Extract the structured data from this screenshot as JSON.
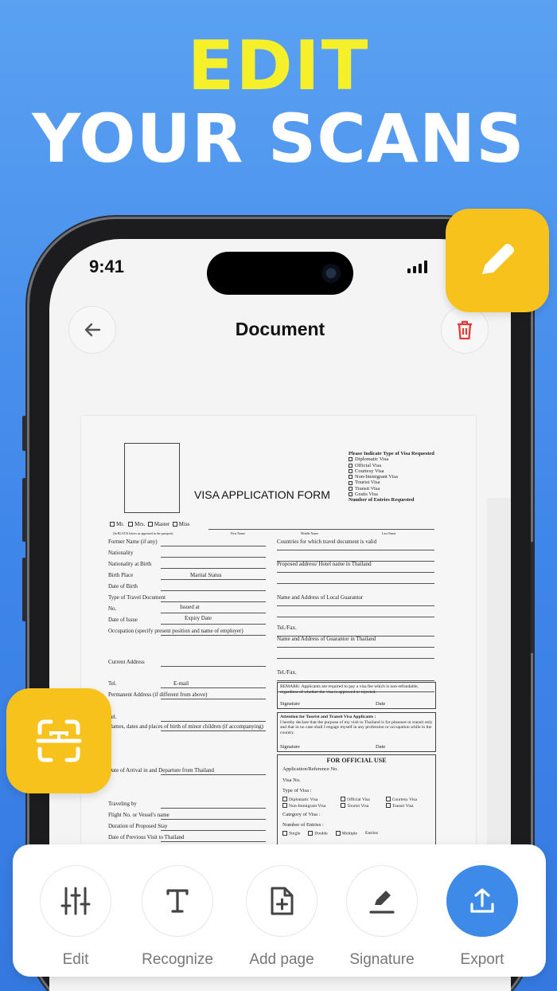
{
  "headline": {
    "line1": "EDIT",
    "line2": "YOUR SCANS"
  },
  "status_bar": {
    "time": "9:41"
  },
  "header": {
    "title": "Document",
    "back_icon": "arrow-left-icon",
    "delete_icon": "trash-icon"
  },
  "colors": {
    "accent": "#3d8ae8",
    "badge": "#f8c21c",
    "danger": "#e53935",
    "headline_yellow": "#f6f02a"
  },
  "document": {
    "form_title": "VISA APPLICATION FORM",
    "visa_types_heading": "Please Indicate Type of Visa Requested",
    "visa_types": [
      "Diplomatic Visa",
      "Official Visa",
      "Courtesy Visa",
      "Non-Immigrant Visa",
      "Tourist Visa",
      "Transit Visa",
      "Gratis Visa"
    ],
    "entries_requested": "Number of Entries Requested",
    "titles": [
      "Mr.",
      "Mrs.",
      "Master",
      "Miss"
    ],
    "name_note": "(In BLOCK letters as appeared in the passport)",
    "name_cols": [
      "First Name",
      "Middle Name",
      "Last Name"
    ],
    "left_fields": [
      "Former Name (if any)",
      "Nationality",
      "Nationality at Birth",
      "Birth Place",
      "Date of Birth",
      "Type of Travel Document",
      "No.",
      "Date of Issue",
      "Occupation (specify present position and name of employer)",
      "Current Address",
      "Tel.",
      "Permanent Address (if different from above)",
      "Tel.",
      "Names, dates and places of birth of minor children (if accompanying)",
      "Date of Arrival in and Departure from Thailand",
      "Traveling by",
      "Flight No. or Vessel's name",
      "Duration of Proposed Stay",
      "Date of Previous Visit to Thailand"
    ],
    "inline_labels": {
      "marital": "Marital Status",
      "issued": "Issued at",
      "expiry": "Expiry Date",
      "email": "E-mail"
    },
    "right_fields": [
      "Countries for which travel document is valid",
      "Proposed address/ Hotel name in Thailand",
      "Name and Address of Local Guarantor",
      "Tel./Fax.",
      "Name and Address of Guarantor in Thailand",
      "Tel./Fax."
    ],
    "remark": "REMARK: Applicants are required to pay a visa fee which is non-refundable, regardless of whether the visa is approved or rejected.",
    "attention_title": "Attention for Tourist and Transit Visa Applicants :",
    "attention_text": "I hereby declare that the purpose of my visit to Thailand is for pleasure or transit only and that in no case shall I engage myself in any profession or occupation while in the country.",
    "signature": "Signature",
    "date": "Date",
    "official": {
      "title": "FOR OFFICIAL USE",
      "fields": [
        "Application/Reference No.",
        "Visa No.",
        "Type of Visa :"
      ],
      "types": [
        "Diplomatic Visa",
        "Official Visa",
        "Courtesy Visa",
        "Non-Immigrant Visa",
        "Tourist Visa",
        "Transit Visa"
      ],
      "category": "Category of Visa :",
      "entries": "Number of Entries :",
      "entry_opts": [
        "Single",
        "Double",
        "Multiple",
        "Entries"
      ]
    }
  },
  "badges": {
    "edit_icon": "pencil-icon",
    "scan_icon": "scan-text-icon"
  },
  "toolbar": {
    "items": [
      {
        "label": "Edit",
        "icon": "sliders-icon"
      },
      {
        "label": "Recognize",
        "icon": "text-icon"
      },
      {
        "label": "Add page",
        "icon": "add-page-icon"
      },
      {
        "label": "Signature",
        "icon": "signature-pen-icon"
      },
      {
        "label": "Export",
        "icon": "export-icon"
      }
    ]
  }
}
